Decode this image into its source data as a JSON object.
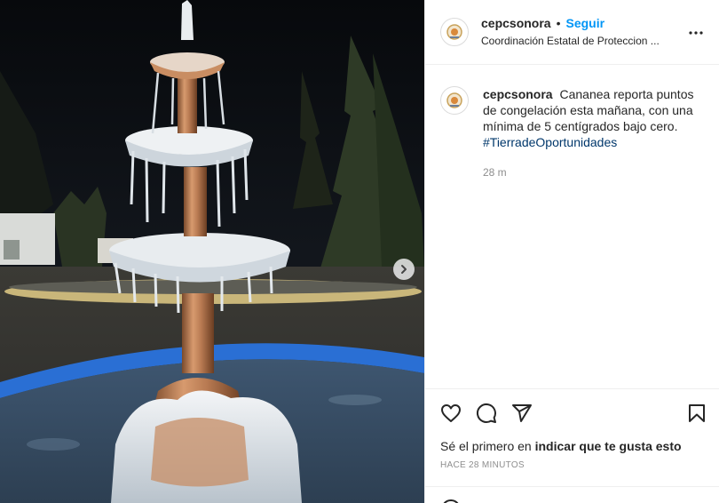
{
  "header": {
    "username": "cepcsonora",
    "separator": "•",
    "follow_label": "Seguir",
    "subtitle": "Coordinación Estatal de Proteccion ...",
    "more_icon": "more-horizontal-icon"
  },
  "caption": {
    "username": "cepcsonora",
    "text": "Cananea reporta puntos de congelación esta mañana, con una mínima de 5 centígrados bajo cero.",
    "hashtag": "#TierradeOportunidades",
    "time": "28 m"
  },
  "media": {
    "next_icon": "chevron-right-icon"
  },
  "actions": {
    "like_icon": "heart-icon",
    "comment_icon": "comment-icon",
    "share_icon": "paper-plane-icon",
    "save_icon": "bookmark-icon"
  },
  "likes": {
    "prefix": "Sé el primero en",
    "link": "indicar que te gusta esto"
  },
  "timestamp": "HACE 28 MINUTOS",
  "colors": {
    "link_blue": "#0095f6",
    "hashtag": "#00376b",
    "muted": "#8e8e8e",
    "border": "#efefef"
  }
}
